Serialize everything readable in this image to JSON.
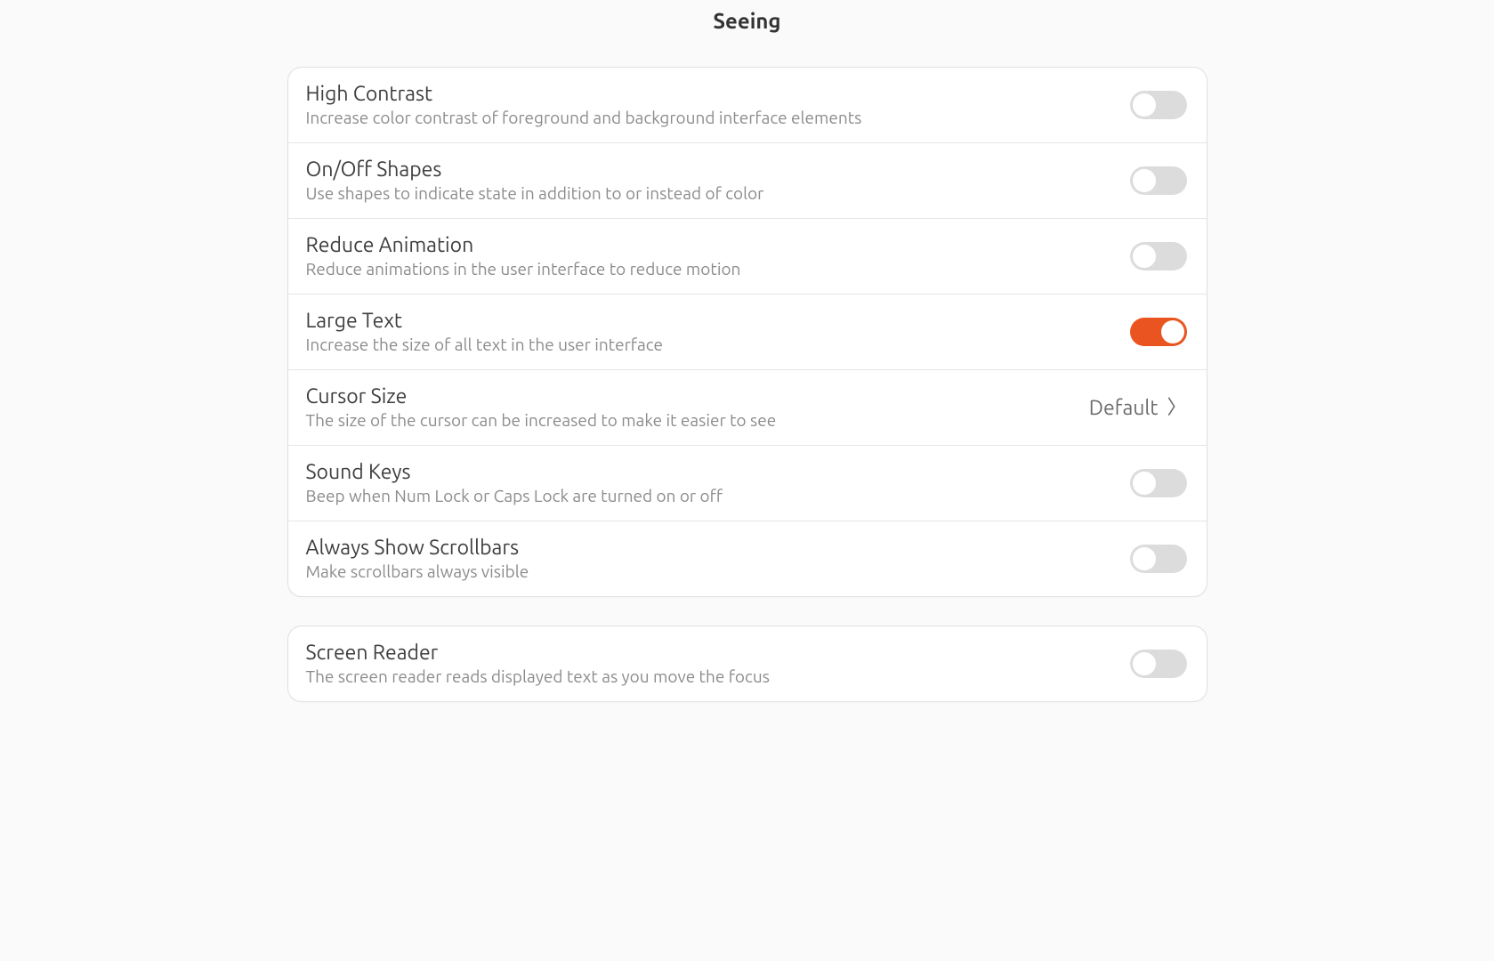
{
  "header": {
    "title": "Seeing"
  },
  "groups": [
    {
      "rows": [
        {
          "id": "high-contrast",
          "title": "High Contrast",
          "subtitle": "Increase color contrast of foreground and background interface elements",
          "type": "toggle",
          "value": false
        },
        {
          "id": "on-off-shapes",
          "title": "On/Off Shapes",
          "subtitle": "Use shapes to indicate state in addition to or instead of color",
          "type": "toggle",
          "value": false
        },
        {
          "id": "reduce-animation",
          "title": "Reduce Animation",
          "subtitle": "Reduce animations in the user interface to reduce motion",
          "type": "toggle",
          "value": false
        },
        {
          "id": "large-text",
          "title": "Large Text",
          "subtitle": "Increase the size of all text in the user interface",
          "type": "toggle",
          "value": true
        },
        {
          "id": "cursor-size",
          "title": "Cursor Size",
          "subtitle": "The size of the cursor can be increased to make it easier to see",
          "type": "select",
          "value": "Default"
        },
        {
          "id": "sound-keys",
          "title": "Sound Keys",
          "subtitle": "Beep when Num Lock or Caps Lock are turned on or off",
          "type": "toggle",
          "value": false
        },
        {
          "id": "always-show-scrollbars",
          "title": "Always Show Scrollbars",
          "subtitle": "Make scrollbars always visible",
          "type": "toggle",
          "value": false
        }
      ]
    },
    {
      "rows": [
        {
          "id": "screen-reader",
          "title": "Screen Reader",
          "subtitle": "The screen reader reads displayed text as you move the focus",
          "type": "toggle",
          "value": false
        }
      ]
    }
  ],
  "colors": {
    "accent": "#e95420",
    "toggle_off_bg": "#dcdcdc",
    "background": "#fafafa",
    "card": "#ffffff",
    "border": "#e0e0e0",
    "text_primary": "#3d3d3d",
    "text_secondary": "#8b8b8b"
  }
}
